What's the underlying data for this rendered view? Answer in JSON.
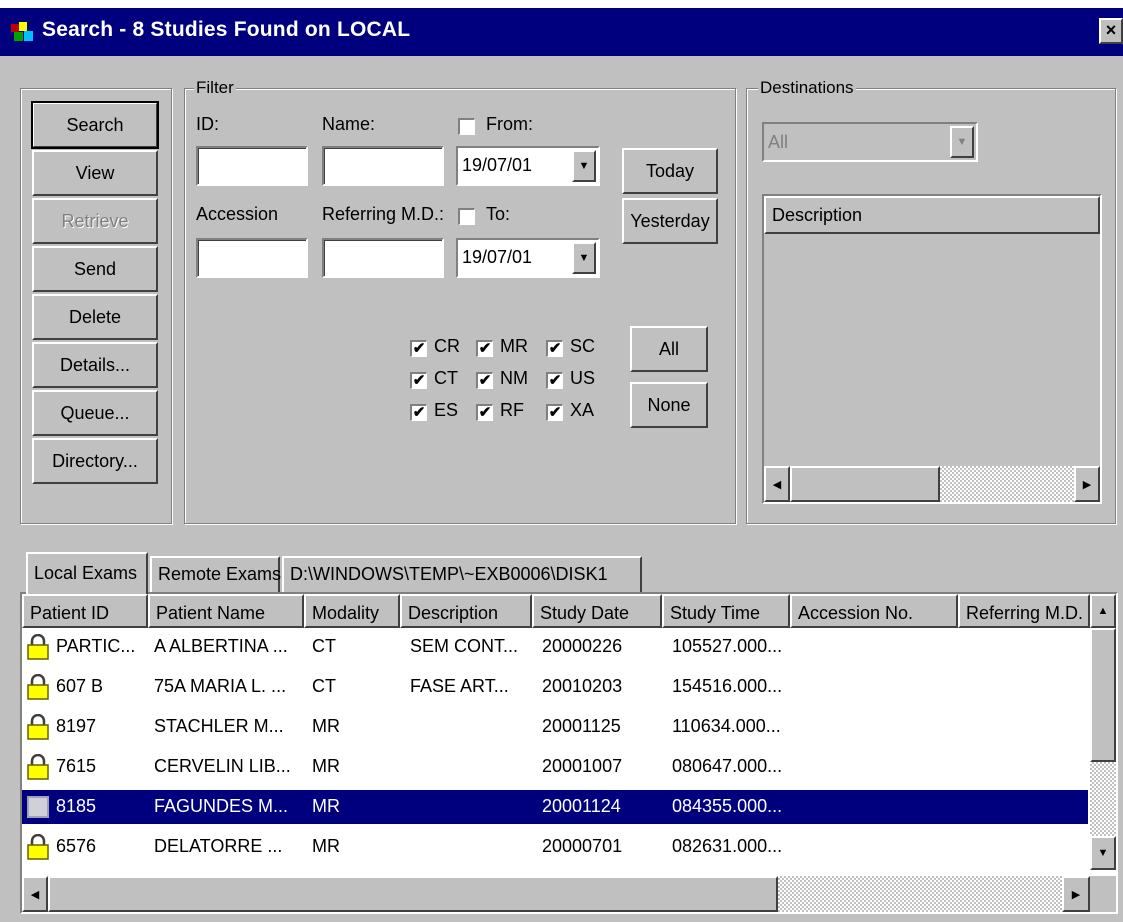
{
  "window": {
    "title": "Search - 8 Studies Found on LOCAL",
    "close_label": "×"
  },
  "actions": [
    {
      "label": "Search",
      "enabled": true,
      "default": true
    },
    {
      "label": "View",
      "enabled": true
    },
    {
      "label": "Retrieve",
      "enabled": false
    },
    {
      "label": "Send",
      "enabled": true
    },
    {
      "label": "Delete",
      "enabled": true
    },
    {
      "label": "Details...",
      "enabled": true
    },
    {
      "label": "Queue...",
      "enabled": true
    },
    {
      "label": "Directory...",
      "enabled": true
    }
  ],
  "filter": {
    "group_label": "Filter",
    "id_label": "ID:",
    "id_value": "",
    "name_label": "Name:",
    "name_value": "",
    "accession_label": "Accession",
    "accession_value": "",
    "referring_label": "Referring M.D.:",
    "referring_value": "",
    "from_label": "From:",
    "from_checked": false,
    "from_value": "19/07/01",
    "to_label": "To:",
    "to_checked": false,
    "to_value": "19/07/01",
    "today_label": "Today",
    "yesterday_label": "Yesterday",
    "all_label": "All",
    "none_label": "None",
    "modalities": [
      {
        "code": "CR",
        "checked": true
      },
      {
        "code": "MR",
        "checked": true
      },
      {
        "code": "SC",
        "checked": true
      },
      {
        "code": "CT",
        "checked": true
      },
      {
        "code": "NM",
        "checked": true
      },
      {
        "code": "US",
        "checked": true
      },
      {
        "code": "ES",
        "checked": true
      },
      {
        "code": "RF",
        "checked": true
      },
      {
        "code": "XA",
        "checked": true
      }
    ]
  },
  "destinations": {
    "group_label": "Destinations",
    "selected": "All",
    "column_header": "Description"
  },
  "tabs": [
    {
      "label": "Local Exams",
      "active": true
    },
    {
      "label": "Remote Exams",
      "active": false
    },
    {
      "label": "D:\\WINDOWS\\TEMP\\~EXB0006\\DISK1",
      "active": false
    }
  ],
  "table": {
    "columns": [
      "Patient ID",
      "Patient Name",
      "Modality",
      "Description",
      "Study Date",
      "Study Time",
      "Accession No.",
      "Referring M.D."
    ],
    "rows": [
      {
        "patient_id": "PARTIC...",
        "patient_name": "A ALBERTINA ...",
        "modality": "CT",
        "description": "SEM CONT...",
        "study_date": "20000226",
        "study_time": "105527.000...",
        "selected": false
      },
      {
        "patient_id": "607 B",
        "patient_name": "75A MARIA L. ...",
        "modality": "CT",
        "description": "FASE ART...",
        "study_date": "20010203",
        "study_time": "154516.000...",
        "selected": false
      },
      {
        "patient_id": "8197",
        "patient_name": "STACHLER M...",
        "modality": "MR",
        "description": "",
        "study_date": "20001125",
        "study_time": "110634.000...",
        "selected": false
      },
      {
        "patient_id": "7615",
        "patient_name": "CERVELIN LIB...",
        "modality": "MR",
        "description": "",
        "study_date": "20001007",
        "study_time": "080647.000...",
        "selected": false
      },
      {
        "patient_id": "8185",
        "patient_name": "FAGUNDES M...",
        "modality": "MR",
        "description": "",
        "study_date": "20001124",
        "study_time": "084355.000...",
        "selected": true
      },
      {
        "patient_id": "6576",
        "patient_name": "DELATORRE ...",
        "modality": "MR",
        "description": "",
        "study_date": "20000701",
        "study_time": "082631.000...",
        "selected": false
      }
    ]
  },
  "colors": {
    "title_bar": "#00007e",
    "face": "#c0c0c0",
    "selection": "#00007e",
    "lock_icon": "#ffff00"
  }
}
